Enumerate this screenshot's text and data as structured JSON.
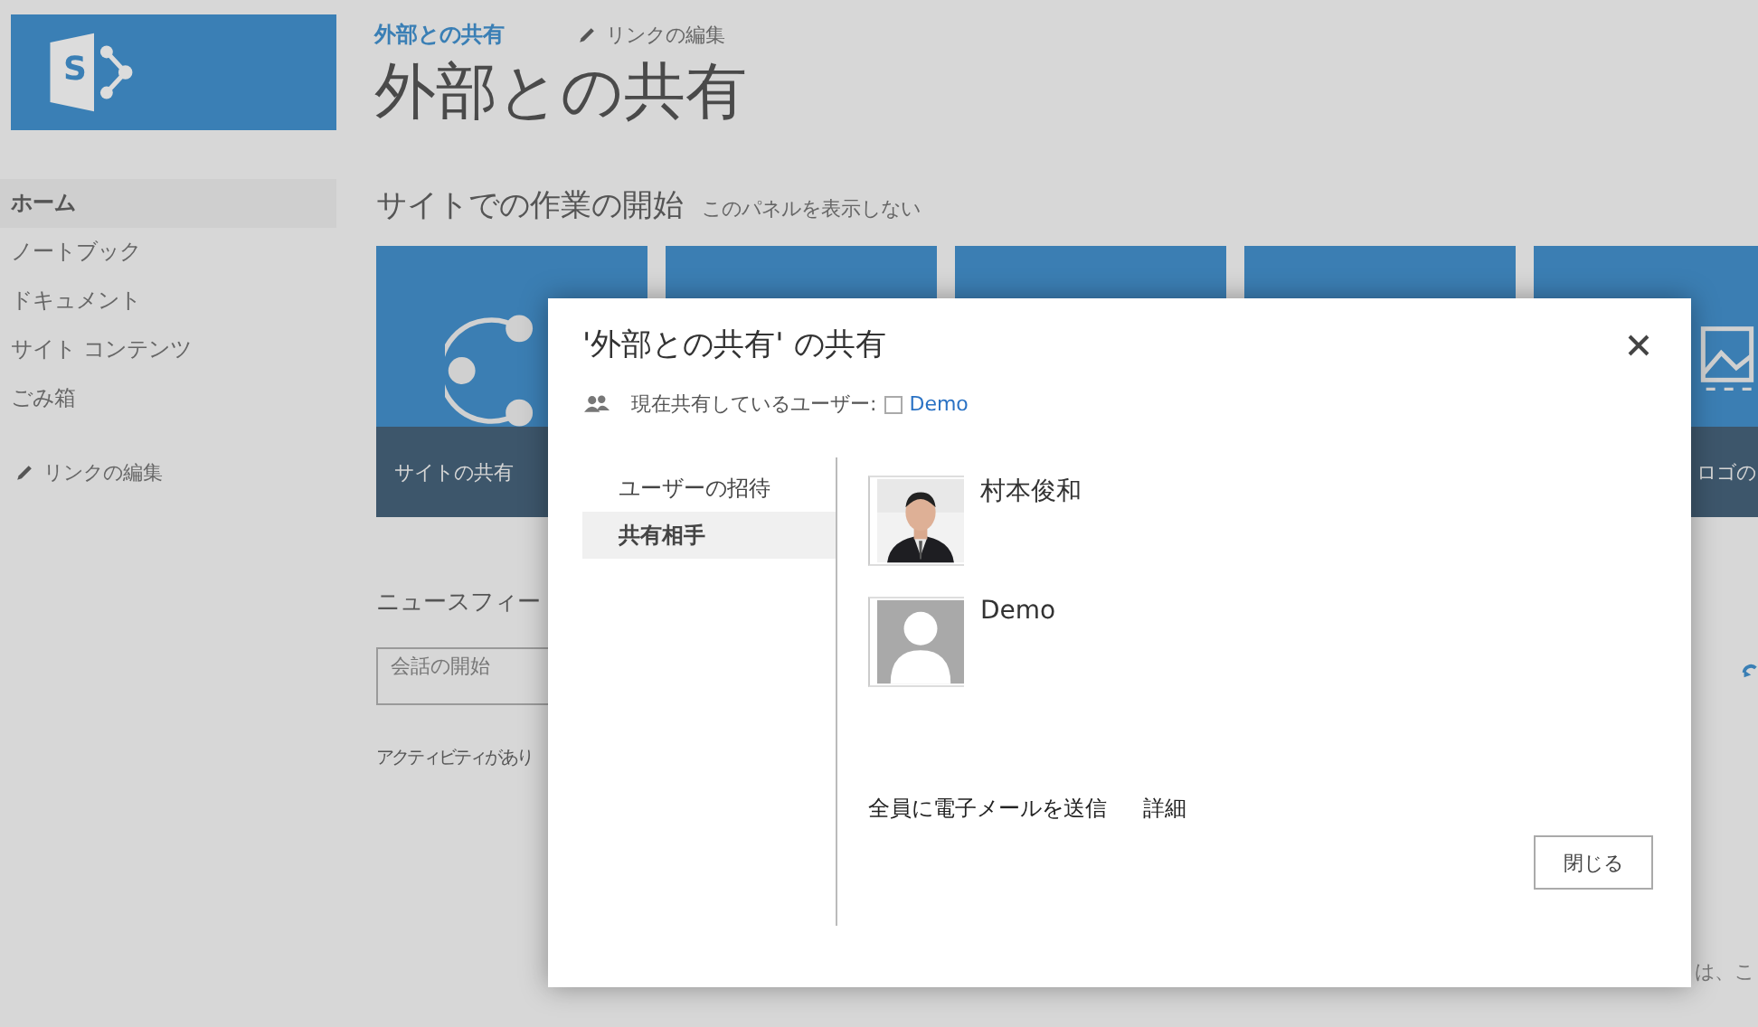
{
  "site": {
    "logo_letter": "S",
    "breadcrumb": "外部との共有",
    "edit_links": "リンクの編集",
    "title": "外部との共有"
  },
  "nav": {
    "items": [
      {
        "label": "ホーム",
        "selected": true
      },
      {
        "label": "ノートブック",
        "selected": false
      },
      {
        "label": "ドキュメント",
        "selected": false
      },
      {
        "label": "サイト コンテンツ",
        "selected": false
      },
      {
        "label": "ごみ箱",
        "selected": false
      }
    ],
    "edit_links": "リンクの編集"
  },
  "getting_started": {
    "heading": "サイトでの作業の開始",
    "hide_link": "このパネルを表示しない",
    "tiles": [
      {
        "kind": "share",
        "label": "サイトの共有"
      },
      {
        "kind": "blank"
      },
      {
        "kind": "blank"
      },
      {
        "kind": "blank"
      },
      {
        "kind": "logo",
        "label": "ロゴの"
      }
    ]
  },
  "newsfeed": {
    "heading": "ニュースフィー",
    "placeholder": "会話の開始",
    "empty_text": "アクティビティがあり",
    "side_text": "は、こ"
  },
  "dialog": {
    "title": "'外部との共有' の共有",
    "shared_with_label": "現在共有しているユーザー:",
    "shared_with_link": "Demo",
    "tabs": [
      {
        "label": "ユーザーの招待",
        "selected": false
      },
      {
        "label": "共有相手",
        "selected": true
      }
    ],
    "people": [
      {
        "name": "村本俊和"
      },
      {
        "kind": "placeholder",
        "name": "Demo"
      }
    ],
    "links": [
      "全員に電子メールを送信",
      "詳細"
    ],
    "close_button": "閉じる"
  }
}
